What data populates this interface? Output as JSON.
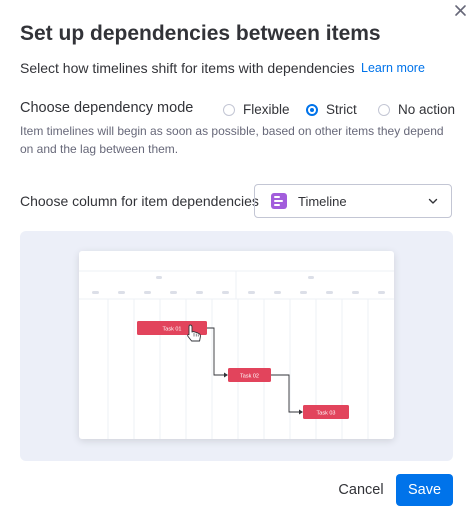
{
  "dialog": {
    "title": "Set up dependencies between items",
    "subtitle": "Select how timelines shift for items with dependencies",
    "learn_more": "Learn more",
    "close_icon": "close-icon"
  },
  "mode": {
    "label": "Choose dependency mode",
    "options": [
      {
        "label": "Flexible",
        "selected": false
      },
      {
        "label": "Strict",
        "selected": true
      },
      {
        "label": "No action",
        "selected": false
      }
    ],
    "description": "Item timelines will begin as soon as possible, based on other items they depend on and the lag between them."
  },
  "column": {
    "label": "Choose column for item dependencies",
    "selected": "Timeline",
    "icon": "timeline-column-icon"
  },
  "preview": {
    "tasks": [
      "Task 01",
      "Task 02",
      "Task 03"
    ],
    "accent": "#e2445c",
    "background": "#eceff8"
  },
  "footer": {
    "cancel": "Cancel",
    "save": "Save",
    "primary_color": "#0073ea"
  }
}
